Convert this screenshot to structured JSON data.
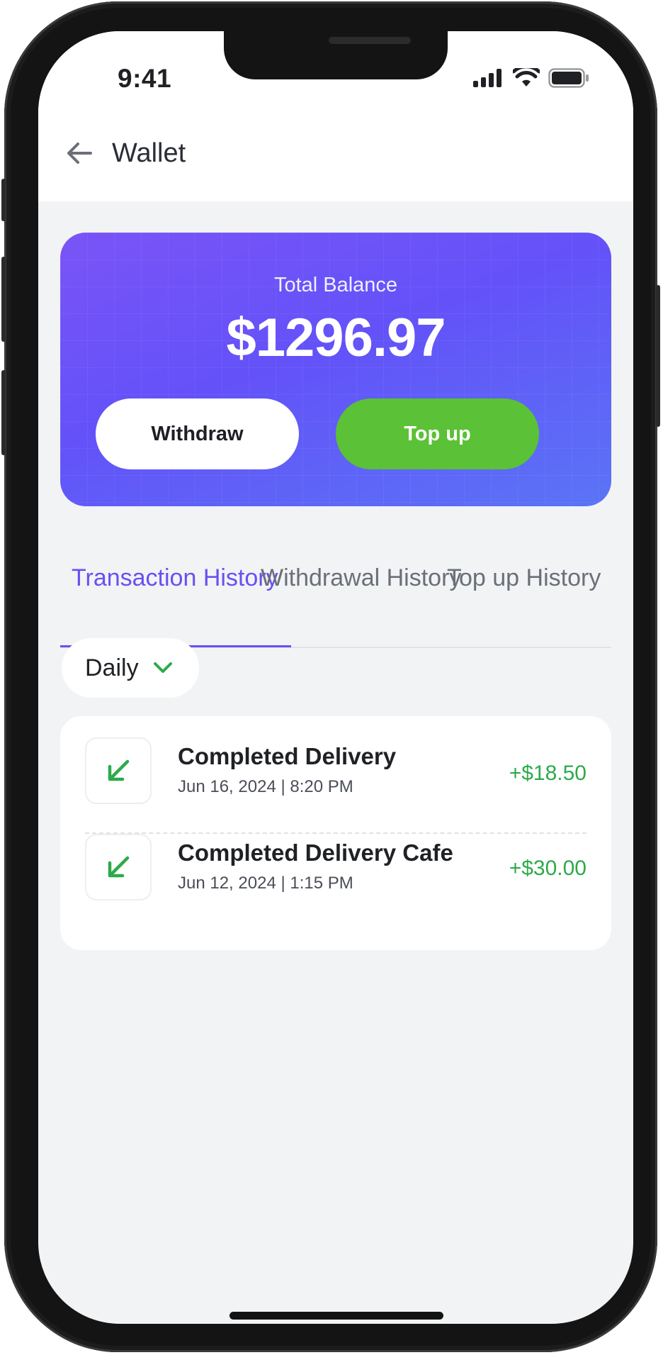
{
  "status_bar": {
    "time": "9:41"
  },
  "header": {
    "title": "Wallet"
  },
  "balance": {
    "label": "Total Balance",
    "amount": "$1296.97",
    "withdraw_label": "Withdraw",
    "topup_label": "Top up"
  },
  "tabs": [
    {
      "label": "Transaction History",
      "active": true
    },
    {
      "label": "Withdrawal History",
      "active": false
    },
    {
      "label": "Top up History",
      "active": false
    }
  ],
  "filter": {
    "selected": "Daily"
  },
  "transactions": [
    {
      "title": "Completed Delivery",
      "date": "Jun 16, 2024 | 8:20 PM",
      "amount": "+$18.50"
    },
    {
      "title": "Completed Delivery Cafe",
      "date": "Jun 12, 2024 | 1:15 PM",
      "amount": "+$30.00"
    }
  ],
  "colors": {
    "accent": "#6a4ff1",
    "topup_green": "#5bc136",
    "income_green": "#2eaa4a"
  },
  "icons": [
    "back-arrow-icon",
    "signal-icon",
    "wifi-icon",
    "battery-icon",
    "chevron-down-icon",
    "arrow-down-left-icon"
  ]
}
